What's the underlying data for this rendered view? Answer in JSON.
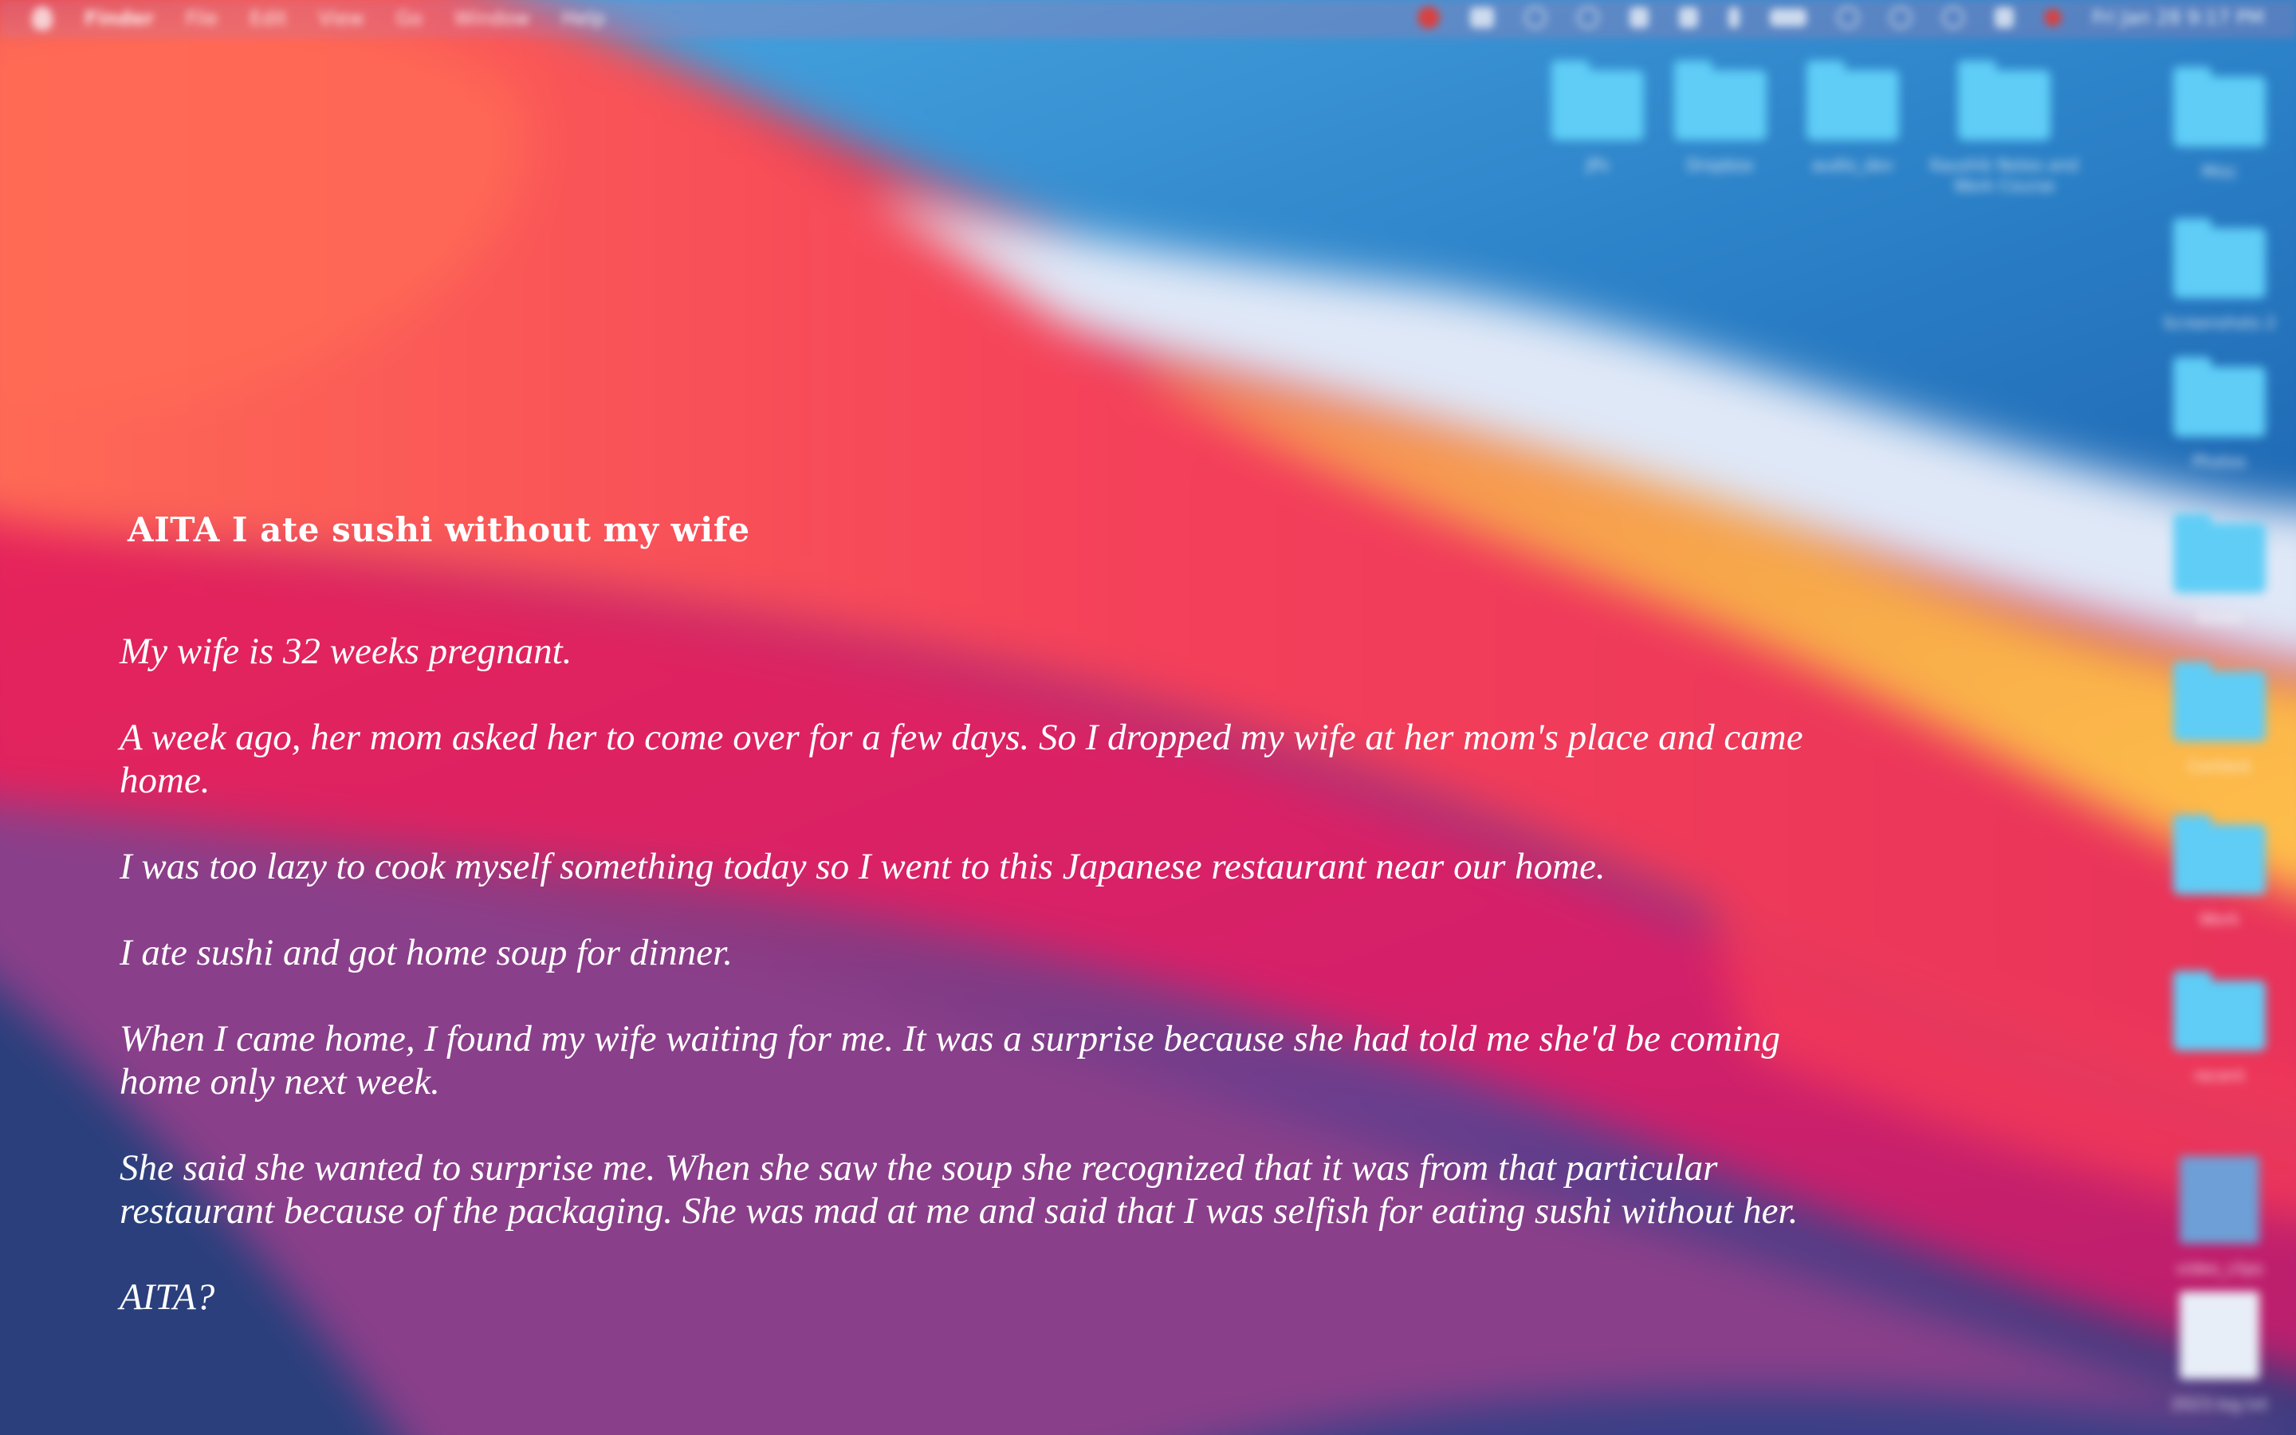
{
  "menubar": {
    "items": [
      "Finder",
      "File",
      "Edit",
      "View",
      "Go",
      "Window",
      "Help"
    ],
    "clock": "Fri Jan 28 9:17 PM"
  },
  "desktop": {
    "top_row": [
      {
        "label": "JPs",
        "icon": "folder-icon"
      },
      {
        "label": "Dropbox",
        "icon": "folder-icon"
      },
      {
        "label": "audio_dev",
        "icon": "folder-icon"
      },
      {
        "label": "Kaushik Notes and Work Course",
        "icon": "folder-icon"
      }
    ],
    "right_column": [
      {
        "label": "Misc",
        "icon": "folder-icon"
      },
      {
        "label": "Screenshots 2",
        "icon": "folder-icon"
      },
      {
        "label": "Photos",
        "icon": "folder-icon"
      },
      {
        "label": "Notes",
        "icon": "folder-icon"
      },
      {
        "label": "Content",
        "icon": "folder-icon"
      },
      {
        "label": "Work",
        "icon": "folder-icon"
      },
      {
        "label": "recent",
        "icon": "folder-icon"
      },
      {
        "label": "video_clips",
        "icon": "document-icon"
      },
      {
        "label": "2023.log.txt",
        "icon": "document-icon"
      }
    ]
  },
  "post": {
    "title": "AITA I ate sushi without my wife",
    "paragraphs": [
      " My wife is 32 weeks pregnant.",
      "A week ago, her mom asked her to come over for a few days. So I dropped my wife at her mom's place and came\n home.",
      "I was too lazy to cook myself something today so I went to this Japanese restaurant near our home.",
      "I ate sushi and got home soup for dinner.",
      "When I came home, I found my wife waiting for me. It was a surprise because she had told me she'd be coming\n home only next week.",
      "She said she wanted to surprise me. When she saw the soup she recognized that it was from that particular\n restaurant because of the packaging. She was mad at me and said that I was selfish for eating sushi without her.",
      "AITA?"
    ]
  }
}
